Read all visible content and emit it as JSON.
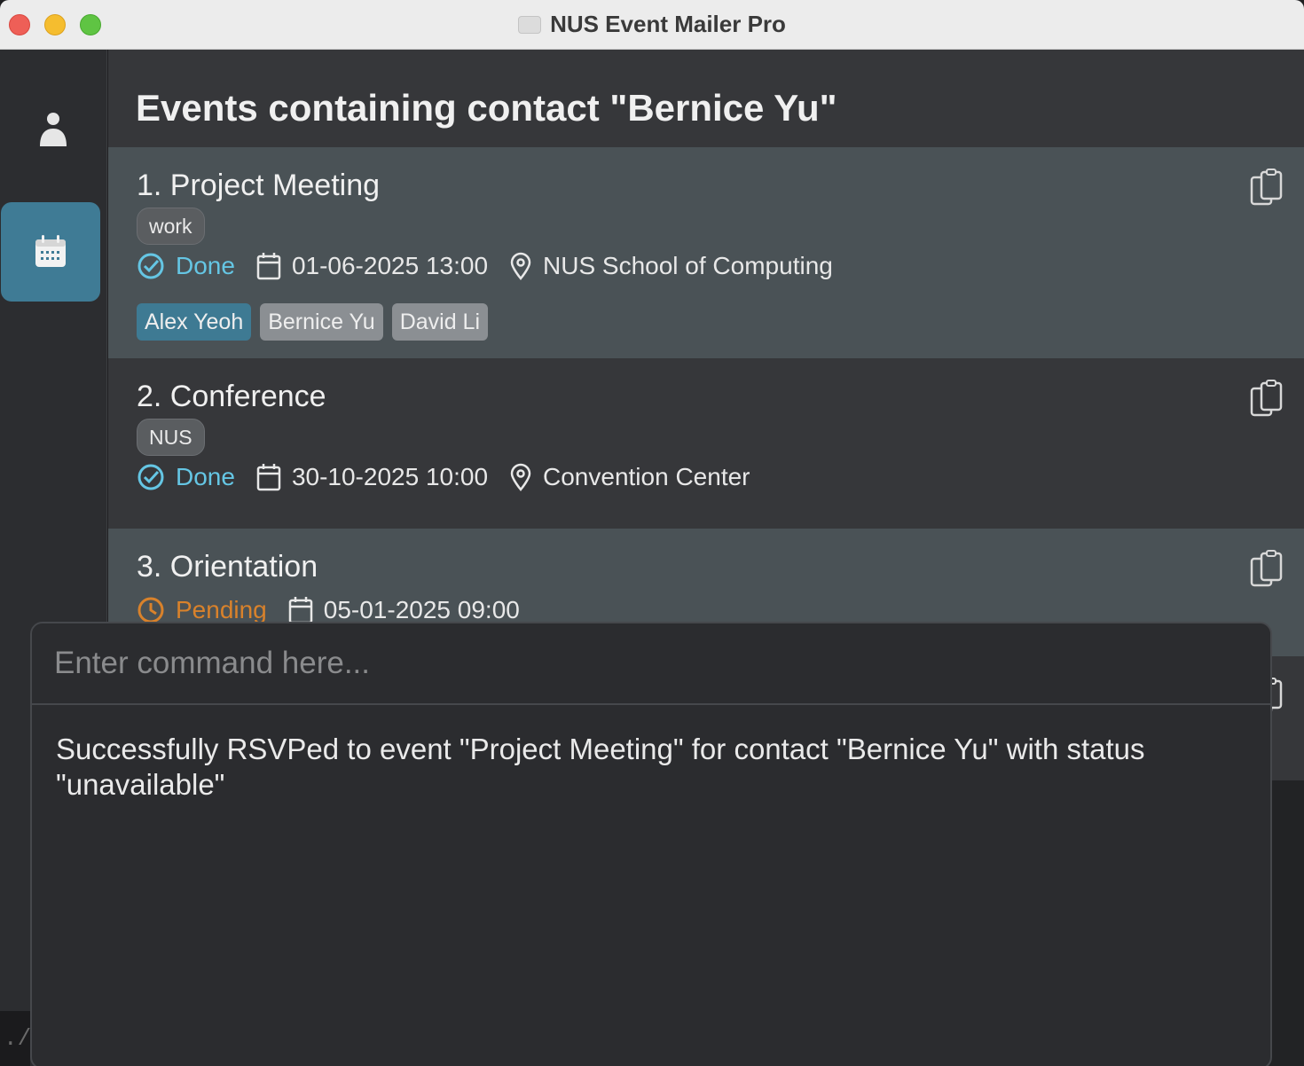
{
  "window": {
    "title": "NUS Event Mailer Pro",
    "traffic_lights": [
      "close",
      "minimize",
      "maximize"
    ]
  },
  "sidebar": {
    "items": [
      {
        "id": "contacts",
        "icon": "person-icon",
        "active": false
      },
      {
        "id": "events",
        "icon": "calendar-icon",
        "active": true
      }
    ]
  },
  "header": {
    "title": "Events containing contact \"Bernice Yu\""
  },
  "events": [
    {
      "title": "1. Project Meeting",
      "tag": "work",
      "status": "Done",
      "datetime": "01-06-2025 13:00",
      "location": "NUS School of Computing",
      "contacts": [
        "Alex Yeoh",
        "Bernice Yu",
        "David Li"
      ]
    },
    {
      "title": "2. Conference",
      "tag": "NUS",
      "status": "Done",
      "datetime": "30-10-2025 10:00",
      "location": "Convention Center"
    },
    {
      "title": "3. Orientation",
      "status": "Pending",
      "datetime": "05-01-2025 09:00"
    }
  ],
  "command_box": {
    "placeholder": "Enter command here...",
    "value": ""
  },
  "result": {
    "message": "Successfully RSVPed to event \"Project Meeting\" for contact \"Bernice Yu\" with status \"unavailable\""
  },
  "terminal_peek": "./d",
  "colors": {
    "accent": "#3f7b95",
    "status_done": "#65c6e4",
    "status_pending": "#d9822b",
    "chip_accepted": "#3e7a93",
    "chip_other": "#8b8f93"
  }
}
